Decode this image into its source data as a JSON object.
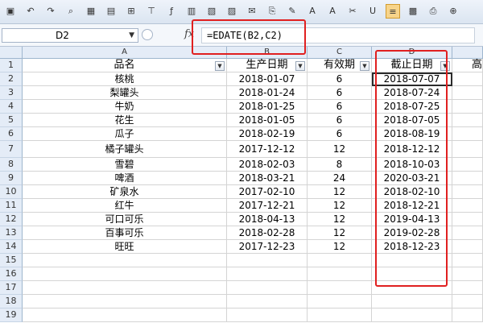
{
  "formula_bar": {
    "cell_ref": "D2",
    "formula": "=EDATE(B2,C2)"
  },
  "columns": [
    "A",
    "B",
    "C",
    "D"
  ],
  "header": {
    "name": "品名",
    "production_date": "生产日期",
    "shelf_life": "有效期",
    "expiry_date": "截止日期",
    "extra": "高"
  },
  "rows": [
    {
      "num": "1"
    },
    {
      "num": "2",
      "name": "核桃",
      "date": "2018-01-07",
      "months": "6",
      "expiry": "2018-07-07"
    },
    {
      "num": "3",
      "name": "梨罐头",
      "date": "2018-01-24",
      "months": "6",
      "expiry": "2018-07-24"
    },
    {
      "num": "4",
      "name": "牛奶",
      "date": "2018-01-25",
      "months": "6",
      "expiry": "2018-07-25"
    },
    {
      "num": "5",
      "name": "花生",
      "date": "2018-01-05",
      "months": "6",
      "expiry": "2018-07-05"
    },
    {
      "num": "6",
      "name": "瓜子",
      "date": "2018-02-19",
      "months": "6",
      "expiry": "2018-08-19"
    },
    {
      "num": "7",
      "name": "橘子罐头",
      "date": "2017-12-12",
      "months": "12",
      "expiry": "2018-12-12"
    },
    {
      "num": "8",
      "name": "雪碧",
      "date": "2018-02-03",
      "months": "8",
      "expiry": "2018-10-03"
    },
    {
      "num": "9",
      "name": "啤酒",
      "date": "2018-03-21",
      "months": "24",
      "expiry": "2020-03-21"
    },
    {
      "num": "10",
      "name": "矿泉水",
      "date": "2017-02-10",
      "months": "12",
      "expiry": "2018-02-10"
    },
    {
      "num": "11",
      "name": "红牛",
      "date": "2017-12-21",
      "months": "12",
      "expiry": "2018-12-21"
    },
    {
      "num": "12",
      "name": "可口可乐",
      "date": "2018-04-13",
      "months": "12",
      "expiry": "2019-04-13"
    },
    {
      "num": "13",
      "name": "百事可乐",
      "date": "2018-02-28",
      "months": "12",
      "expiry": "2019-02-28"
    },
    {
      "num": "14",
      "name": "旺旺",
      "date": "2017-12-23",
      "months": "12",
      "expiry": "2018-12-23"
    },
    {
      "num": "15"
    },
    {
      "num": "16"
    },
    {
      "num": "17"
    },
    {
      "num": "18"
    },
    {
      "num": "19"
    }
  ],
  "toolbar_icons": [
    "save-icon",
    "undo-icon",
    "redo-icon",
    "print-preview-icon",
    "table-icon",
    "grid-icon",
    "merge-icon",
    "filter-icon",
    "function-icon",
    "chart-icon",
    "image-icon",
    "folder-icon",
    "mail-icon",
    "copy-icon",
    "format-painter-icon",
    "sort-asc-icon",
    "font-size-icon",
    "cut-icon",
    "underline-icon",
    "align-icon",
    "calc-icon",
    "print-icon",
    "zoom-icon"
  ]
}
